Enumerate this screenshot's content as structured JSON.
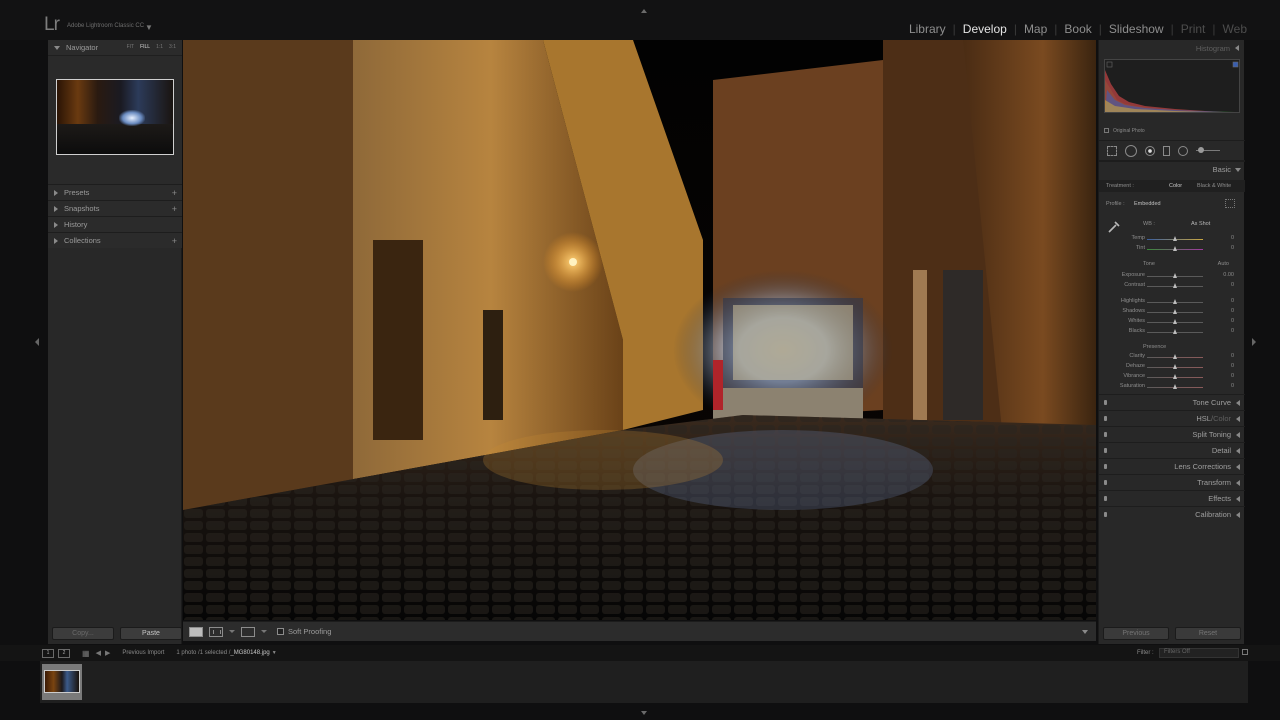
{
  "app": {
    "logo": "Lr",
    "name": "Adobe Lightroom Classic CC",
    "menu_arrow": "▼"
  },
  "modules": [
    {
      "label": "Library",
      "state": "normal"
    },
    {
      "label": "Develop",
      "state": "active"
    },
    {
      "label": "Map",
      "state": "normal"
    },
    {
      "label": "Book",
      "state": "normal"
    },
    {
      "label": "Slideshow",
      "state": "normal"
    },
    {
      "label": "Print",
      "state": "dim"
    },
    {
      "label": "Web",
      "state": "dim"
    }
  ],
  "left_panel": {
    "navigator": {
      "title": "Navigator",
      "options": [
        "FIT",
        "FILL",
        "1:1",
        "3:1"
      ],
      "active_option": "FILL"
    },
    "sections": [
      {
        "label": "Presets",
        "has_plus": true
      },
      {
        "label": "Snapshots",
        "has_plus": true
      },
      {
        "label": "History",
        "has_plus": false
      },
      {
        "label": "Collections",
        "has_plus": true
      }
    ],
    "copy_label": "Copy...",
    "paste_label": "Paste"
  },
  "toolbar": {
    "soft_proofing_label": "Soft Proofing"
  },
  "right_panel": {
    "histogram_title": "Histogram",
    "original_photo_label": "Original Photo",
    "basic": {
      "title": "Basic",
      "treatment_label": "Treatment :",
      "treatment_color": "Color",
      "treatment_bw": "Black & White",
      "profile_label": "Profile :",
      "profile_value": "Embedded",
      "wb_label": "WB :",
      "wb_value": "As Shot",
      "tone_label": "Tone",
      "tone_auto": "Auto",
      "presence_label": "Presence",
      "sliders": [
        {
          "label": "Temp",
          "value": "0",
          "pos": 0.5
        },
        {
          "label": "Tint",
          "value": "0",
          "pos": 0.5
        },
        {
          "label": "Exposure",
          "value": "0.00",
          "pos": 0.5
        },
        {
          "label": "Contrast",
          "value": "0",
          "pos": 0.5
        },
        {
          "label": "Highlights",
          "value": "0",
          "pos": 0.5
        },
        {
          "label": "Shadows",
          "value": "0",
          "pos": 0.5
        },
        {
          "label": "Whites",
          "value": "0",
          "pos": 0.5
        },
        {
          "label": "Blacks",
          "value": "0",
          "pos": 0.5
        },
        {
          "label": "Clarity",
          "value": "0",
          "pos": 0.5
        },
        {
          "label": "Dehaze",
          "value": "0",
          "pos": 0.5
        },
        {
          "label": "Vibrance",
          "value": "0",
          "pos": 0.5
        },
        {
          "label": "Saturation",
          "value": "0",
          "pos": 0.5
        }
      ]
    },
    "panels": [
      {
        "label": "Tone Curve"
      },
      {
        "label": "HSL",
        "extra": "Color"
      },
      {
        "label": "Split Toning"
      },
      {
        "label": "Detail"
      },
      {
        "label": "Lens Corrections"
      },
      {
        "label": "Transform"
      },
      {
        "label": "Effects"
      },
      {
        "label": "Calibration"
      }
    ],
    "previous_label": "Previous",
    "reset_label": "Reset"
  },
  "filmstrip": {
    "monitor_1": "1",
    "monitor_2": "2",
    "source": "Previous Import",
    "count": "1 photo /1 selected /",
    "filename": "_MG80148.jpg",
    "filter_label": "Filter :",
    "filter_value": "Filters Off"
  },
  "colors": {
    "accent_active": "#e4e4e4",
    "panel_bg": "#282828"
  }
}
